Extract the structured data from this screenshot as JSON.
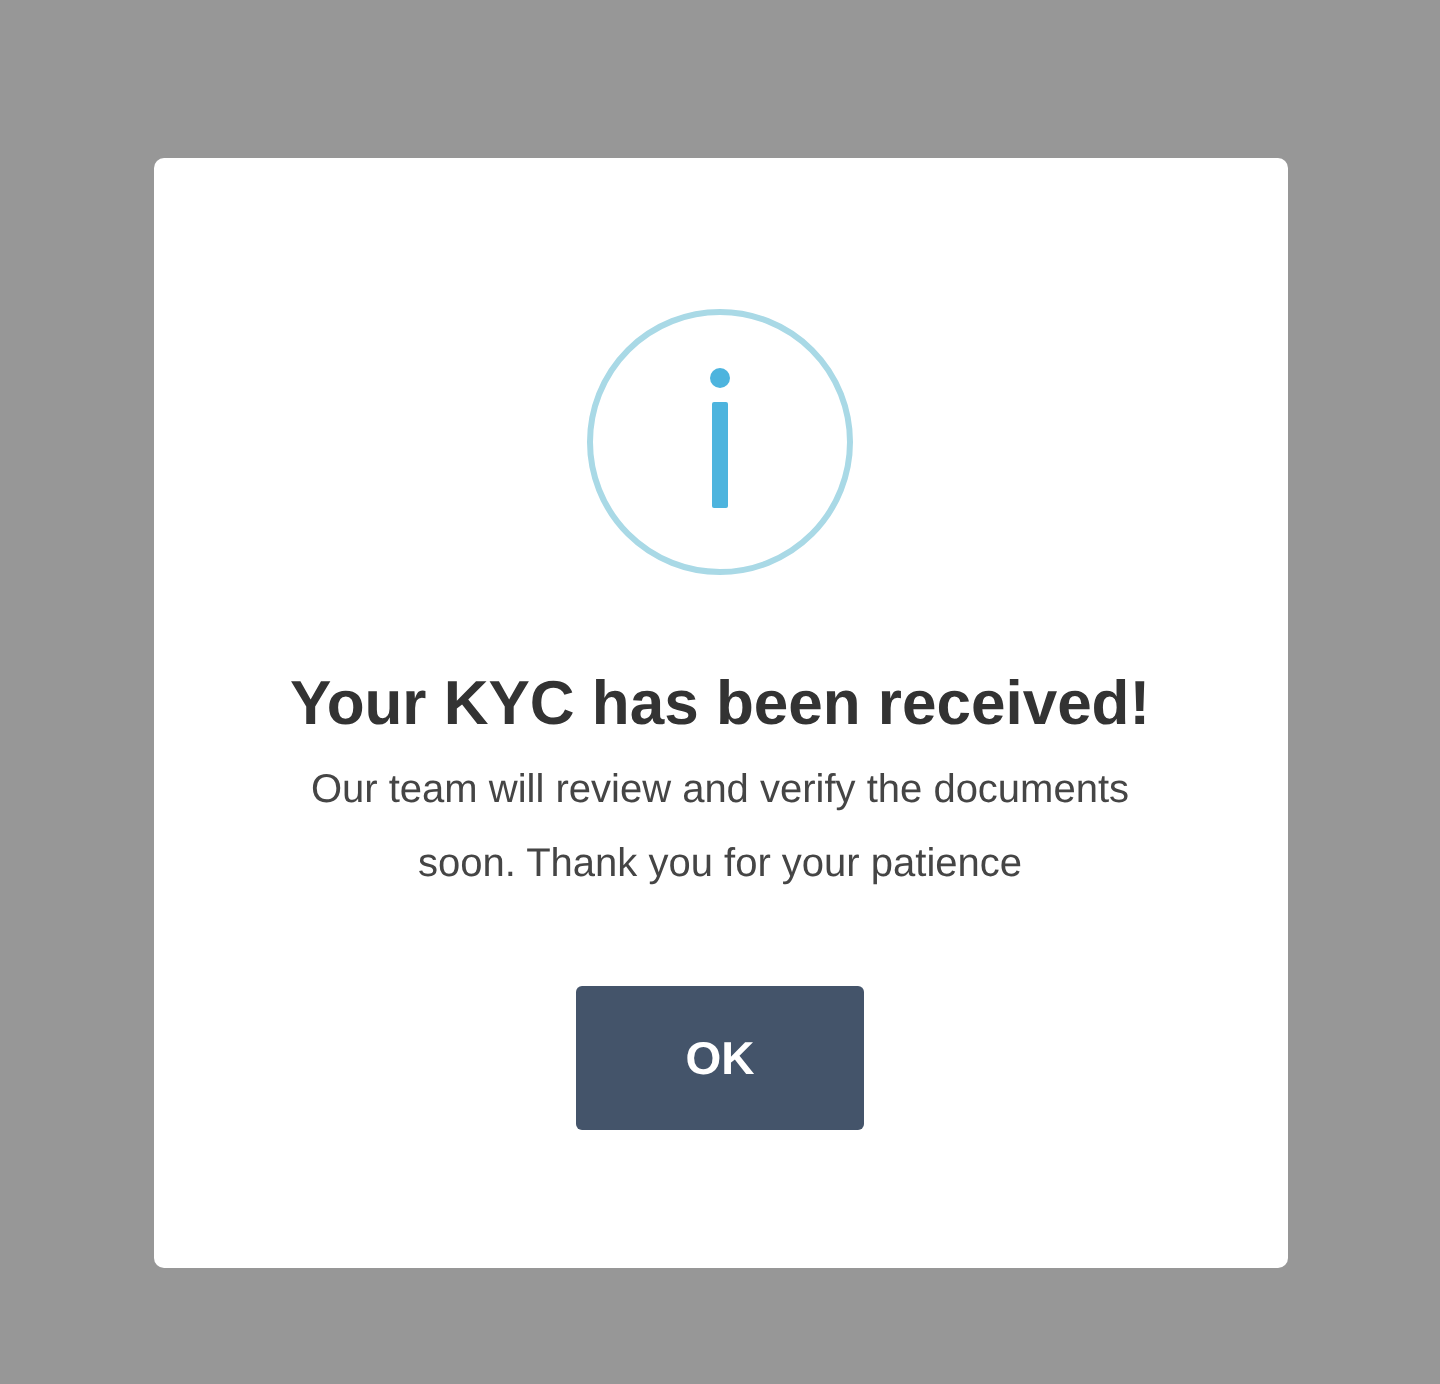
{
  "dialog": {
    "title": "Your KYC has been received!",
    "message": "Our team will review and verify the documents soon. Thank you for your patience",
    "buttons": [
      "OK"
    ]
  }
}
